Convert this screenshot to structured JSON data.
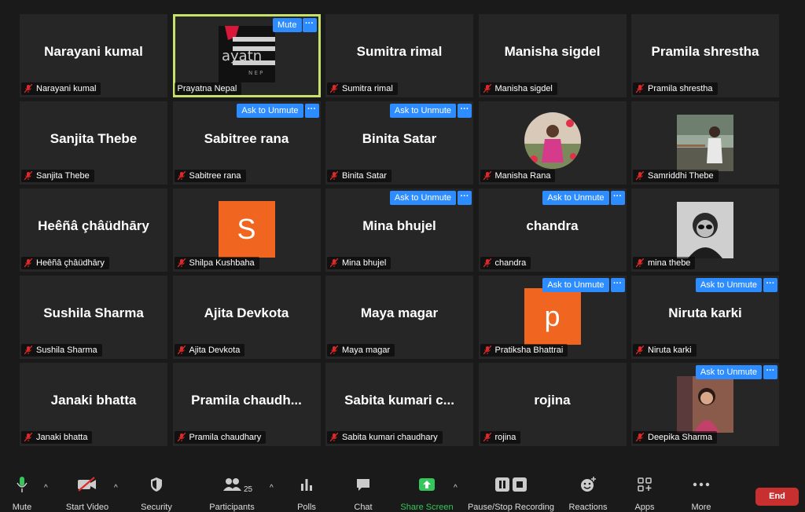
{
  "grid": {
    "tiles": [
      {
        "big": "Narayani kumal",
        "label": "Narayani kumal"
      },
      {
        "big": "",
        "label": "Prayatna Nepal",
        "mute_button": "Mute",
        "more": "···",
        "logo_text": "ayatn",
        "logo_sub": "N E P"
      },
      {
        "big": "Sumitra rimal",
        "label": "Sumitra rimal"
      },
      {
        "big": "Manisha sigdel",
        "label": "Manisha sigdel"
      },
      {
        "big": "Pramila shrestha",
        "label": "Pramila shrestha"
      },
      {
        "big": "Sanjita Thebe",
        "label": "Sanjita Thebe"
      },
      {
        "big": "Sabitree rana",
        "label": "Sabitree rana",
        "ask": "Ask to Unmute",
        "more": "···"
      },
      {
        "big": "Binita Satar",
        "label": "Binita Satar",
        "ask": "Ask to Unmute",
        "more": "···"
      },
      {
        "big": "",
        "label": "Manisha Rana"
      },
      {
        "big": "",
        "label": "Samriddhi Thebe"
      },
      {
        "big": "Heêñâ çhâüdhāry",
        "label": "Heêñâ çhâüdhāry"
      },
      {
        "big": "",
        "label": "Shilpa Kushbaha",
        "letter": "S"
      },
      {
        "big": "Mina bhujel",
        "label": "Mina bhujel",
        "ask": "Ask to Unmute",
        "more": "···"
      },
      {
        "big": "chandra",
        "label": "chandra",
        "ask": "Ask to Unmute",
        "more": "···"
      },
      {
        "big": "",
        "label": "mina thebe"
      },
      {
        "big": "Sushila Sharma",
        "label": "Sushila Sharma"
      },
      {
        "big": "Ajita Devkota",
        "label": "Ajita Devkota"
      },
      {
        "big": "Maya magar",
        "label": "Maya magar"
      },
      {
        "big": "",
        "label": "Pratiksha Bhattrai",
        "letter": "p",
        "ask": "Ask to Unmute",
        "more": "···"
      },
      {
        "big": "Niruta karki",
        "label": "Niruta karki",
        "ask": "Ask to Unmute",
        "more": "···"
      },
      {
        "big": "Janaki bhatta",
        "label": "Janaki bhatta"
      },
      {
        "big": "Pramila  chaudh...",
        "label": "Pramila chaudhary"
      },
      {
        "big": "Sabita kumari c...",
        "label": "Sabita kumari chaudhary"
      },
      {
        "big": "rojina",
        "label": "rojina"
      },
      {
        "big": "",
        "label": "Deepika Sharma",
        "ask": "Ask to Unmute",
        "more": "···"
      }
    ]
  },
  "toolbar": {
    "mute": "Mute",
    "start_video": "Start Video",
    "security": "Security",
    "participants": "Participants",
    "participants_count": "25",
    "polls": "Polls",
    "chat": "Chat",
    "share_screen": "Share Screen",
    "pause_recording": "Pause/Stop Recording",
    "reactions": "Reactions",
    "apps": "Apps",
    "more": "More",
    "end": "End"
  },
  "colors": {
    "accent_blue": "#2d8cff",
    "active_border": "#c8e06c",
    "mic_muted": "#e02828",
    "share_green": "#34c759",
    "end_red": "#c7302f",
    "avatar_orange": "#f0651f"
  }
}
